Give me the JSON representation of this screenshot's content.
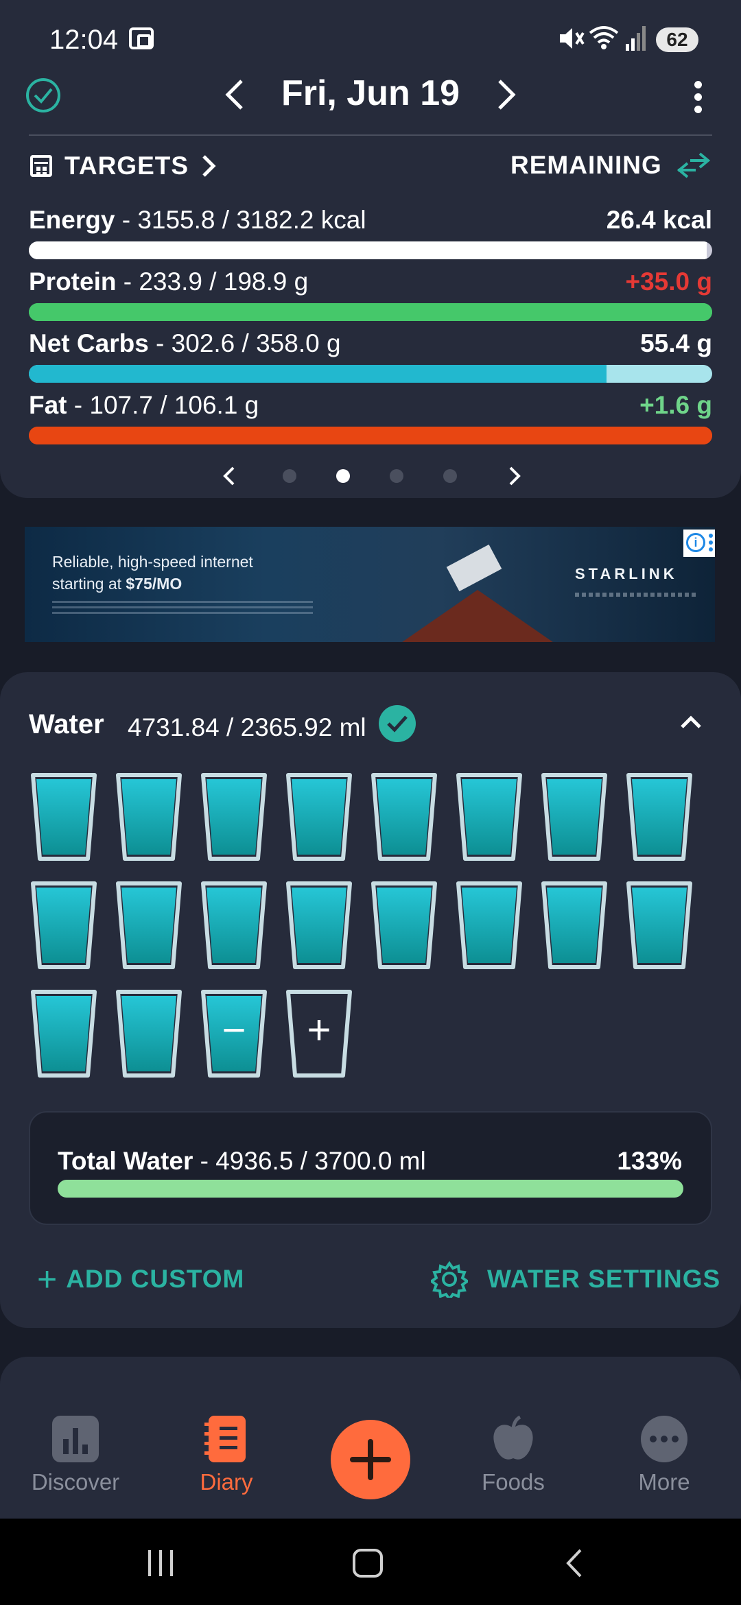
{
  "status": {
    "time": "12:04",
    "battery": "62"
  },
  "header": {
    "date": "Fri, Jun 19",
    "targets_label": "TARGETS",
    "remaining_label": "REMAINING"
  },
  "nutrients": [
    {
      "name": "Energy",
      "detail": " - 3155.8 / 3182.2 kcal",
      "remaining": "26.4 kcal",
      "remaining_color": "#ffffff",
      "fill_color": "#ffffff",
      "track_color": "#c9c9d8",
      "fill_fraction": 0.992
    },
    {
      "name": "Protein",
      "detail": " - 233.9 / 198.9 g",
      "remaining": "+35.0 g",
      "remaining_color": "#e53935",
      "fill_color": "#45c86a",
      "track_color": "#45c86a",
      "fill_fraction": 1.0
    },
    {
      "name": "Net Carbs",
      "detail": " - 302.6 / 358.0 g",
      "remaining": "55.4 g",
      "remaining_color": "#ffffff",
      "fill_color": "#22b8cf",
      "track_color": "#a8e4ec",
      "fill_fraction": 0.845
    },
    {
      "name": "Fat",
      "detail": " - 107.7 / 106.1 g",
      "remaining": "+1.6 g",
      "remaining_color": "#6fd58a",
      "fill_color": "#e84612",
      "track_color": "#e84612",
      "fill_fraction": 1.0
    }
  ],
  "pager": {
    "page_count": 4,
    "active_index": 1
  },
  "ad": {
    "line1": "Reliable, high-speed internet",
    "line2_prefix": "starting at ",
    "price": "$75/MO",
    "brand": "STARLINK",
    "info_glyph": "i"
  },
  "water": {
    "title": "Water",
    "amount": "4731.84 / 2365.92 ml",
    "filled_glasses": 19,
    "minus_glyph": "−",
    "plus_glyph": "+",
    "total_label": "Total Water",
    "total_detail": " - 4936.5 / 3700.0 ml",
    "total_percent": "133%",
    "add_custom": "ADD CUSTOM",
    "water_settings": "WATER SETTINGS"
  },
  "nav": {
    "discover": "Discover",
    "diary": "Diary",
    "foods": "Foods",
    "more": "More"
  },
  "colors": {
    "accent_teal": "#2bb3a2",
    "accent_orange": "#ff6b3d",
    "water": "#1fb8c4"
  },
  "icons": [
    "check-circle-icon",
    "chevron-left-icon",
    "chevron-right-icon",
    "more-vert-icon",
    "calendar-icon",
    "swap-icon",
    "chevron-up-icon",
    "plus-icon",
    "gear-icon",
    "chart-icon",
    "notebook-icon",
    "apple-icon",
    "more-horiz-icon"
  ]
}
